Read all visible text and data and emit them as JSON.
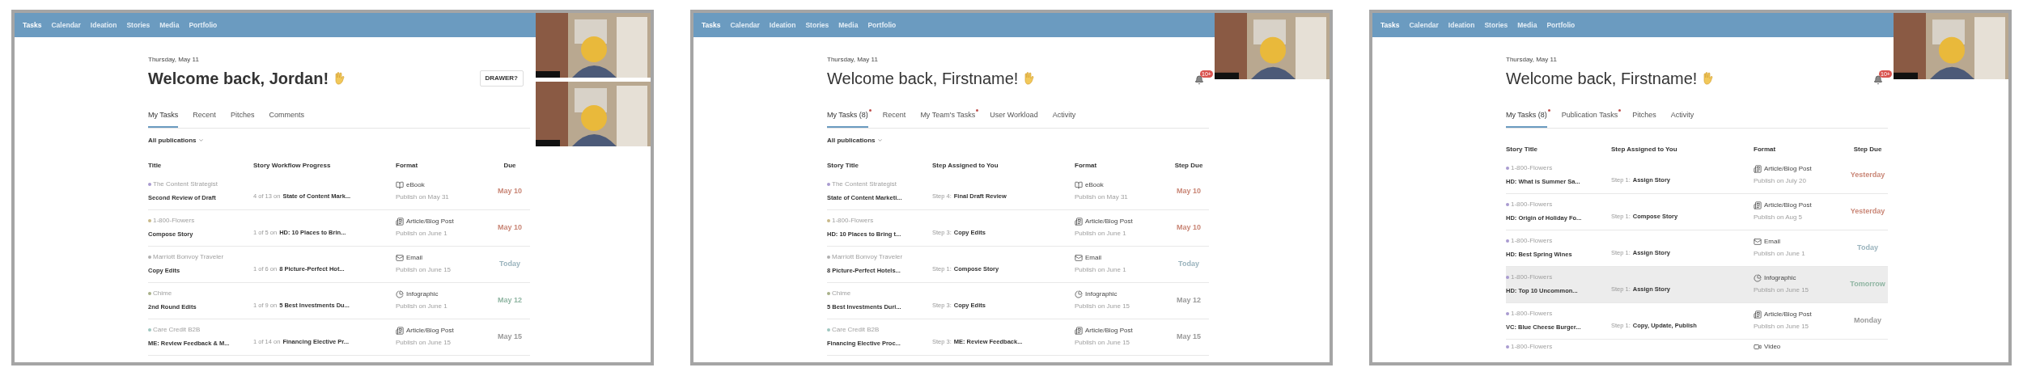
{
  "panels": [
    {
      "nav": [
        {
          "label": "Tasks",
          "selected": true
        },
        {
          "label": "Calendar",
          "selected": false
        },
        {
          "label": "Ideation",
          "selected": false
        },
        {
          "label": "Stories",
          "selected": false
        },
        {
          "label": "Media",
          "selected": false
        },
        {
          "label": "Portfolio",
          "selected": false
        }
      ],
      "video_tiles": [
        {
          "kind": "picture"
        },
        {
          "kind": "picture"
        }
      ],
      "date": "Thursday, May 11",
      "greeting": "Welcome back, Jordan!",
      "header_action": {
        "kind": "button",
        "label": "DRAWER?"
      },
      "tabs": [
        {
          "label": "My Tasks",
          "selected": true,
          "dot": false
        },
        {
          "label": "Recent",
          "selected": false,
          "dot": false
        },
        {
          "label": "Pitches",
          "selected": false,
          "dot": false
        },
        {
          "label": "Comments",
          "selected": false,
          "dot": false
        }
      ],
      "filter": "All publications",
      "columns": [
        "Title",
        "Story Workflow Progress",
        "Format",
        "Due"
      ],
      "rows": [
        {
          "publication": "The Content Strategist",
          "color": "#a99bd0",
          "title": "Second Review of Draft",
          "step_prefix": "4 of 13 on",
          "step_name": "State of Content Mark...",
          "format": {
            "kind": "ebook",
            "label": "eBook"
          },
          "publish": "Publish on May 31",
          "due": {
            "text": "May 10",
            "color": "#c98676"
          },
          "highlighted": false
        },
        {
          "publication": "1-800-Flowers",
          "color": "#c9b98a",
          "title": "Compose Story",
          "step_prefix": "1 of 5 on",
          "step_name": "HD: 10 Places to Brin...",
          "format": {
            "kind": "article",
            "label": "Article/Blog Post"
          },
          "publish": "Publish on June 1",
          "due": {
            "text": "May 10",
            "color": "#c98676"
          },
          "highlighted": false
        },
        {
          "publication": "Marriott Bonvoy Traveler",
          "color": "#b0b0b0",
          "title": "Copy Edits",
          "step_prefix": "1 of 6 on",
          "step_name": "8 Picture-Perfect Hot...",
          "format": {
            "kind": "email",
            "label": "Email"
          },
          "publish": "Publish on June 15",
          "due": {
            "text": "Today",
            "color": "#9ab3bd"
          },
          "highlighted": false
        },
        {
          "publication": "Chime",
          "color": "#a8b08a",
          "title": "2nd Round Edits",
          "step_prefix": "1 of 9 on",
          "step_name": "5 Best Investments Du...",
          "format": {
            "kind": "infographic",
            "label": "Infographic"
          },
          "publish": "Publish on June 1",
          "due": {
            "text": "May 12",
            "color": "#8fb5a2"
          },
          "highlighted": false
        },
        {
          "publication": "Care Credit B2B",
          "color": "#9fc7c0",
          "title": "ME: Review Feedback & M...",
          "step_prefix": "1 of 14 on",
          "step_name": "Financing Elective Pr...",
          "format": {
            "kind": "article",
            "label": "Article/Blog Post"
          },
          "publish": "Publish on June 15",
          "due": {
            "text": "May 15",
            "color": "#9a9a9a"
          },
          "highlighted": false
        }
      ]
    },
    {
      "nav": [
        {
          "label": "Tasks",
          "selected": true
        },
        {
          "label": "Calendar",
          "selected": false
        },
        {
          "label": "Ideation",
          "selected": false
        },
        {
          "label": "Stories",
          "selected": false
        },
        {
          "label": "Media",
          "selected": false
        },
        {
          "label": "Portfolio",
          "selected": false
        }
      ],
      "video_tiles": [
        {
          "kind": "picture"
        }
      ],
      "date": "Thursday, May 11",
      "greeting": "Welcome back, Firstname!",
      "header_action": {
        "kind": "bell",
        "label": "10+"
      },
      "tabs": [
        {
          "label": "My Tasks (8)",
          "selected": true,
          "dot": true
        },
        {
          "label": "Recent",
          "selected": false,
          "dot": false
        },
        {
          "label": "My Team's Tasks",
          "selected": false,
          "dot": true
        },
        {
          "label": "User Workload",
          "selected": false,
          "dot": false
        },
        {
          "label": "Activity",
          "selected": false,
          "dot": false
        }
      ],
      "filter": "All publications",
      "columns": [
        "Story Title",
        "Step Assigned to You",
        "Format",
        "Step Due"
      ],
      "rows": [
        {
          "publication": "The Content Strategist",
          "color": "#a99bd0",
          "title": "State of Content Marketi...",
          "step_prefix": "Step 4:",
          "step_name": "Final Draft Review",
          "format": {
            "kind": "ebook",
            "label": "eBook"
          },
          "publish": "Publish on May 31",
          "due": {
            "text": "May 10",
            "color": "#c98676"
          },
          "highlighted": false
        },
        {
          "publication": "1-800-Flowers",
          "color": "#c9b98a",
          "title": "HD: 10 Places to Bring t...",
          "step_prefix": "Step 3:",
          "step_name": "Copy Edits",
          "format": {
            "kind": "article",
            "label": "Article/Blog Post"
          },
          "publish": "Publish on June 1",
          "due": {
            "text": "May 10",
            "color": "#c98676"
          },
          "highlighted": false
        },
        {
          "publication": "Marriott Bonvoy Traveler",
          "color": "#b0b0b0",
          "title": "8 Picture-Perfect Hotels...",
          "step_prefix": "Step 1:",
          "step_name": "Compose Story",
          "format": {
            "kind": "email",
            "label": "Email"
          },
          "publish": "Publish on June 1",
          "due": {
            "text": "Today",
            "color": "#9ab3bd"
          },
          "highlighted": false
        },
        {
          "publication": "Chime",
          "color": "#a8b08a",
          "title": "5 Best Investments Duri...",
          "step_prefix": "Step 3:",
          "step_name": "Copy Edits",
          "format": {
            "kind": "infographic",
            "label": "Infographic"
          },
          "publish": "Publish on June 15",
          "due": {
            "text": "May 12",
            "color": "#9a9a9a"
          },
          "highlighted": false
        },
        {
          "publication": "Care Credit B2B",
          "color": "#9fc7c0",
          "title": "Financing Elective Proc...",
          "step_prefix": "Step 3:",
          "step_name": "ME: Review Feedback...",
          "format": {
            "kind": "article",
            "label": "Article/Blog Post"
          },
          "publish": "Publish on June 15",
          "due": {
            "text": "May 15",
            "color": "#9a9a9a"
          },
          "highlighted": false
        }
      ]
    },
    {
      "nav": [
        {
          "label": "Tasks",
          "selected": true
        },
        {
          "label": "Calendar",
          "selected": false
        },
        {
          "label": "Ideation",
          "selected": false
        },
        {
          "label": "Stories",
          "selected": false
        },
        {
          "label": "Media",
          "selected": false
        },
        {
          "label": "Portfolio",
          "selected": false
        }
      ],
      "video_tiles": [
        {
          "kind": "picture"
        }
      ],
      "date": "Thursday, May 11",
      "greeting": "Welcome back, Firstname!",
      "header_action": {
        "kind": "bell",
        "label": "10+"
      },
      "tabs": [
        {
          "label": "My Tasks (8)",
          "selected": true,
          "dot": true
        },
        {
          "label": "Publication Tasks",
          "selected": false,
          "dot": true
        },
        {
          "label": "Pitches",
          "selected": false,
          "dot": false
        },
        {
          "label": "Activity",
          "selected": false,
          "dot": false
        }
      ],
      "columns": [
        "Story Title",
        "Step Assigned to You",
        "Format",
        "Step Due"
      ],
      "rows": [
        {
          "publication": "1-800-Flowers",
          "color": "#a99bd0",
          "title": "HD: What is Summer Sa...",
          "step_prefix": "Step 1:",
          "step_name": "Assign Story",
          "format": {
            "kind": "article",
            "label": "Article/Blog Post"
          },
          "publish": "Publish on July 20",
          "due": {
            "text": "Yesterday",
            "color": "#c98676"
          },
          "highlighted": false
        },
        {
          "publication": "1-800-Flowers",
          "color": "#a99bd0",
          "title": "HD: Origin of Holiday Fo...",
          "step_prefix": "Step 1:",
          "step_name": "Compose Story",
          "format": {
            "kind": "article",
            "label": "Article/Blog Post"
          },
          "publish": "Publish on Aug 5",
          "due": {
            "text": "Yesterday",
            "color": "#c98676"
          },
          "highlighted": false
        },
        {
          "publication": "1-800-Flowers",
          "color": "#a99bd0",
          "title": "HD: Best Spring Wines",
          "step_prefix": "Step 1:",
          "step_name": "Assign Story",
          "format": {
            "kind": "email",
            "label": "Email"
          },
          "publish": "Publish on June 1",
          "due": {
            "text": "Today",
            "color": "#9ab3bd"
          },
          "highlighted": false
        },
        {
          "publication": "1-800-Flowers",
          "color": "#a99bd0",
          "title": "HD: Top 10 Uncommon...",
          "step_prefix": "Step 1:",
          "step_name": "Assign Story",
          "format": {
            "kind": "infographic",
            "label": "Infographic"
          },
          "publish": "Publish on June 15",
          "due": {
            "text": "Tomorrow",
            "color": "#8fb5a2"
          },
          "highlighted": true
        },
        {
          "publication": "1-800-Flowers",
          "color": "#a99bd0",
          "title": "VC: Blue Cheese Burger...",
          "step_prefix": "Step 1:",
          "step_name": "Copy, Update, Publish",
          "format": {
            "kind": "article",
            "label": "Article/Blog Post"
          },
          "publish": "Publish on June 15",
          "due": {
            "text": "Monday",
            "color": "#9a9a9a"
          },
          "highlighted": false
        },
        {
          "publication": "1-800-Flowers",
          "color": "#a99bd0",
          "format": {
            "kind": "video",
            "label": "Video"
          },
          "highlighted": false
        }
      ]
    }
  ]
}
